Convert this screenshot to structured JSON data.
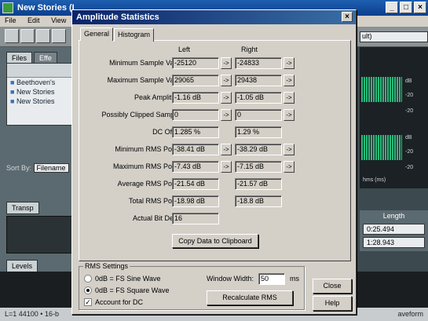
{
  "app": {
    "title": "New Stories (I",
    "menu": [
      "File",
      "Edit",
      "View"
    ],
    "files_tabs": [
      "Files",
      "Effe"
    ],
    "files": [
      "Beethoven's",
      "New Stories",
      "New Stories"
    ],
    "sort_by_label": "Sort By:",
    "sort_by_value": "Filename",
    "transport_tab": "Transp",
    "levels_tab": "Levels",
    "status_left": "L=1 44100 • 16-b",
    "status_right": "aveform",
    "right_dropdown": "ult)",
    "scale_marks": [
      "dB",
      "-20",
      "-20",
      "dB",
      "-20",
      "-20"
    ],
    "bottom_scale": "hms (ms)",
    "length": {
      "header": "Length",
      "values": [
        "0:25.494",
        "1:28.943"
      ]
    }
  },
  "dialog": {
    "title": "Amplitude Statistics",
    "close_glyph": "×",
    "tabs": [
      "General",
      "Histogram"
    ],
    "columns": {
      "left": "Left",
      "right": "Right"
    },
    "rows": [
      {
        "label": "Minimum Sample Value:",
        "left": "-25120",
        "right": "-24833",
        "buttons": true
      },
      {
        "label": "Maximum Sample Value:",
        "left": "29065",
        "right": "29438",
        "buttons": true
      },
      {
        "label": "Peak Amplitude:",
        "left": "-1.16 dB",
        "right": "-1.05 dB",
        "buttons": true
      },
      {
        "label": "Possibly Clipped Samples:",
        "left": "0",
        "right": "0",
        "buttons": true
      },
      {
        "label": "DC Offset:",
        "left": "1.285 %",
        "right": "1.29 %",
        "buttons": false
      },
      {
        "label": "Minimum RMS Power:",
        "left": "-38.41 dB",
        "right": "-38.29 dB",
        "buttons": true
      },
      {
        "label": "Maximum RMS Power:",
        "left": "-7.43 dB",
        "right": "-7.15 dB",
        "buttons": true
      },
      {
        "label": "Average RMS Power:",
        "left": "-21.54 dB",
        "right": "-21.57 dB",
        "buttons": false
      },
      {
        "label": "Total RMS Power:",
        "left": "-18.98 dB",
        "right": "-18.8 dB",
        "buttons": false
      },
      {
        "label": "Actual Bit Depth:",
        "left": "16",
        "right": null,
        "buttons": false
      }
    ],
    "arrow_glyph": "->",
    "copy_button": "Copy Data to Clipboard",
    "rms_settings": {
      "title": "RMS Settings",
      "option1": "0dB = FS Sine Wave",
      "option2": "0dB = FS Square Wave",
      "selected": "0dB = FS Square Wave",
      "account_for_dc": "Account for DC",
      "account_for_dc_checked": true,
      "window_width_label": "Window Width:",
      "window_width_value": "50",
      "window_width_unit": "ms",
      "recalculate": "Recalculate RMS"
    },
    "close_button": "Close",
    "help_button": "Help"
  }
}
